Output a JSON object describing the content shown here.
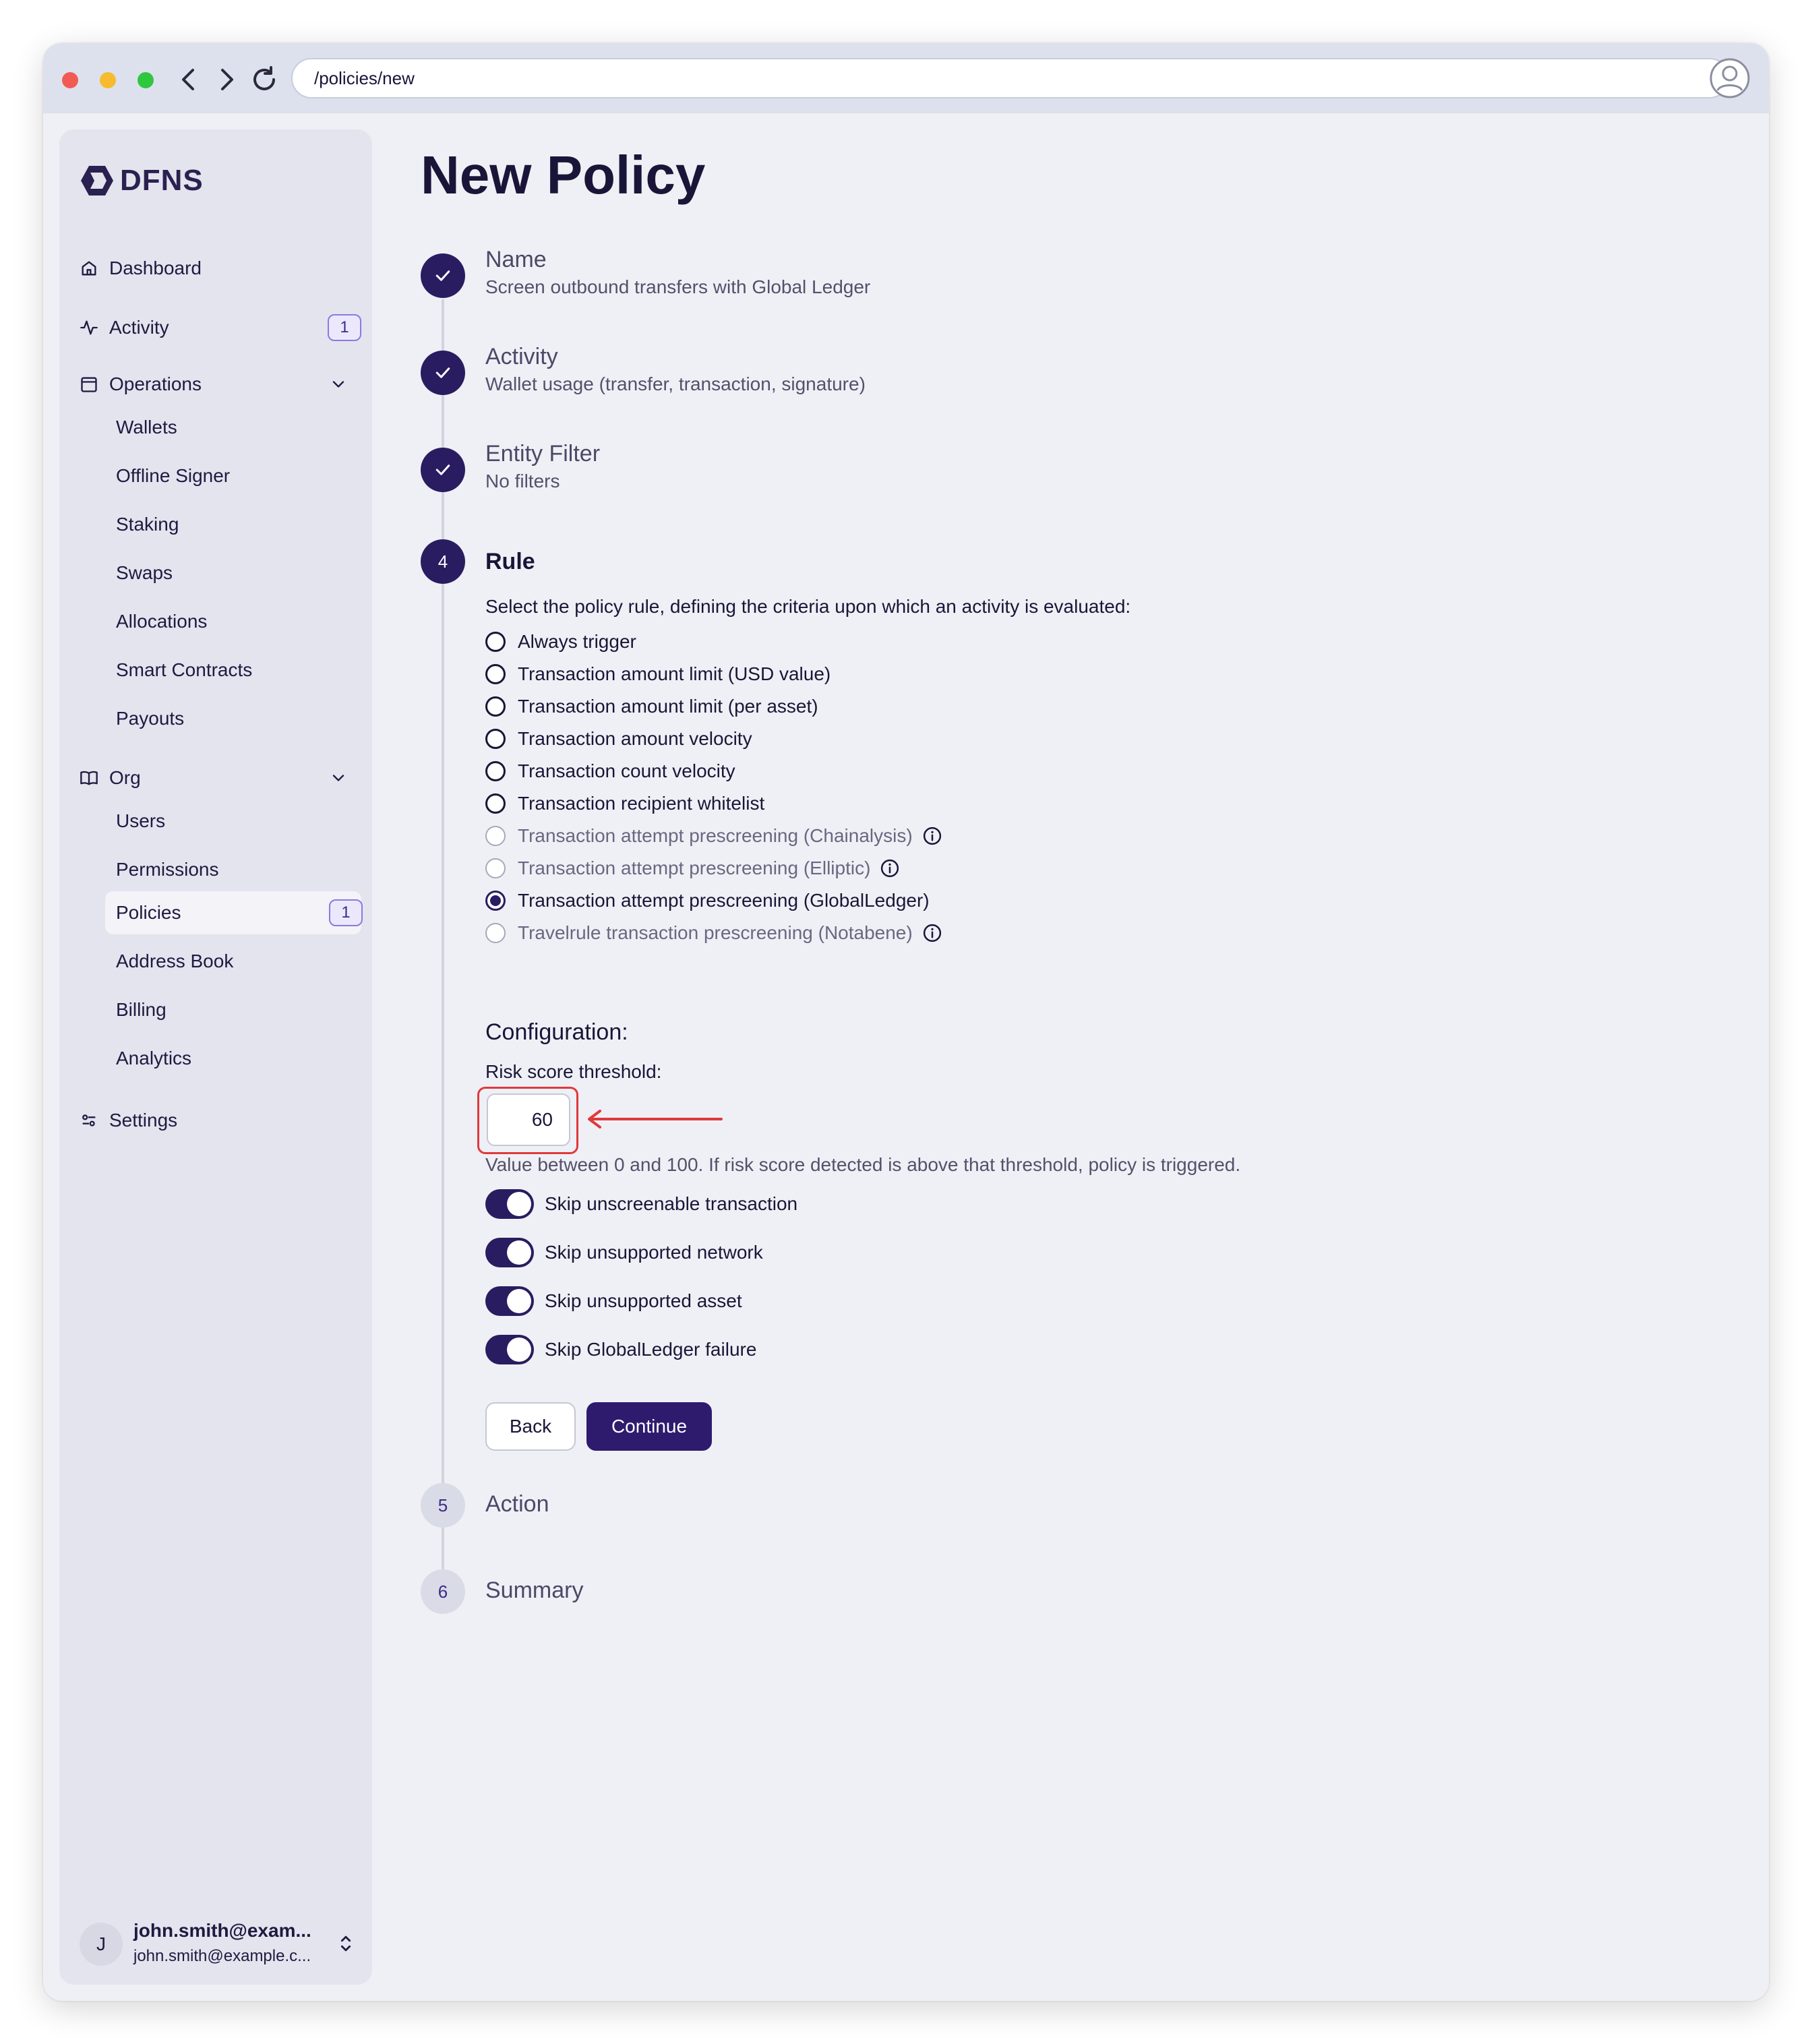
{
  "browser": {
    "url": "/policies/new"
  },
  "sidebar": {
    "logo_text": "DFNS",
    "items": {
      "dashboard": "Dashboard",
      "activity": "Activity",
      "activity_badge": "1",
      "operations": "Operations",
      "org": "Org",
      "settings": "Settings"
    },
    "operations_items": [
      "Wallets",
      "Offline Signer",
      "Staking",
      "Swaps",
      "Allocations",
      "Smart Contracts",
      "Payouts"
    ],
    "org_items": [
      "Users",
      "Permissions",
      "Policies",
      "Address Book",
      "Billing",
      "Analytics"
    ],
    "policies_badge": "1",
    "active_item": "Policies",
    "user": {
      "initial": "J",
      "name": "john.smith@exam...",
      "email": "john.smith@example.c..."
    }
  },
  "page": {
    "title": "New Policy"
  },
  "steps": [
    {
      "number": "",
      "title": "Name",
      "subtitle": "Screen outbound transfers with Global Ledger",
      "status": "complete"
    },
    {
      "number": "",
      "title": "Activity",
      "subtitle": "Wallet usage (transfer, transaction, signature)",
      "status": "complete"
    },
    {
      "number": "",
      "title": "Entity Filter",
      "subtitle": "No filters",
      "status": "complete"
    },
    {
      "number": "4",
      "title": "Rule",
      "subtitle": "",
      "status": "active"
    },
    {
      "number": "5",
      "title": "Action",
      "subtitle": "",
      "status": "todo"
    },
    {
      "number": "6",
      "title": "Summary",
      "subtitle": "",
      "status": "todo"
    }
  ],
  "rule": {
    "intro": "Select the policy rule, defining the criteria upon which an activity is evaluated:",
    "options": [
      {
        "label": "Always trigger",
        "state": "enabled"
      },
      {
        "label": "Transaction amount limit (USD value)",
        "state": "enabled"
      },
      {
        "label": "Transaction amount limit (per asset)",
        "state": "enabled"
      },
      {
        "label": "Transaction amount velocity",
        "state": "enabled"
      },
      {
        "label": "Transaction count velocity",
        "state": "enabled"
      },
      {
        "label": "Transaction recipient whitelist",
        "state": "enabled"
      },
      {
        "label": "Transaction attempt prescreening (Chainalysis)",
        "state": "disabled",
        "info": true
      },
      {
        "label": "Transaction attempt prescreening (Elliptic)",
        "state": "disabled",
        "info": true
      },
      {
        "label": "Transaction attempt prescreening (GlobalLedger)",
        "state": "selected"
      },
      {
        "label": "Travelrule transaction prescreening (Notabene)",
        "state": "disabled",
        "info": true
      }
    ],
    "selected": "Transaction attempt prescreening (GlobalLedger)"
  },
  "configuration": {
    "title": "Configuration:",
    "risk_label": "Risk score threshold:",
    "risk_value": "60",
    "help_text": "Value between 0 and 100. If risk score detected is above that threshold, policy is triggered.",
    "toggles": [
      {
        "label": "Skip unscreenable transaction",
        "on": true
      },
      {
        "label": "Skip unsupported network",
        "on": true
      },
      {
        "label": "Skip unsupported asset",
        "on": true
      },
      {
        "label": "Skip GlobalLedger failure",
        "on": true
      }
    ]
  },
  "buttons": {
    "back": "Back",
    "continue": "Continue"
  },
  "colors": {
    "brand": "#2a1c60",
    "highlight": "#e0393c",
    "badge_border": "#8c79e0"
  },
  "icons": {
    "dashboard": "home-icon",
    "activity": "activity-pulse-icon",
    "operations": "calendar-icon",
    "org": "book-icon",
    "settings": "sliders-icon",
    "step_complete": "check-icon",
    "info": "info-icon"
  }
}
